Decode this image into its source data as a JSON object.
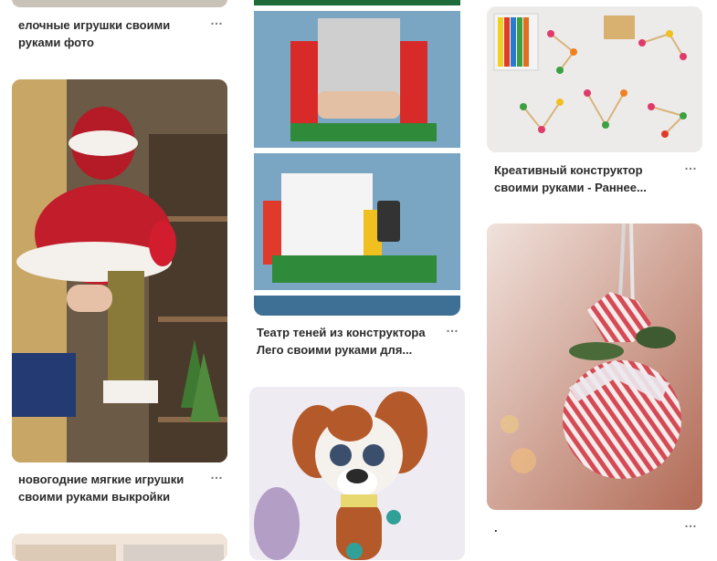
{
  "pins": [
    {
      "title": "елочные игрушки своими руками фото",
      "image": "christmas-toys-photo"
    },
    {
      "title": "новогодние мягкие игрушки своими руками выкройки",
      "image": "santa-claus-soft-toy"
    },
    {
      "title": "Театр теней из конструктора Лего своими руками для...",
      "image": "lego-shadow-theater"
    },
    {
      "title": "",
      "image": "crochet-dog-toy"
    },
    {
      "title": "Креативный конструктор своими руками - Раннее...",
      "image": "plasticine-stick-constructor"
    },
    {
      "title": ".",
      "image": "striped-christmas-ball"
    },
    {
      "title": "",
      "image": "beaded-pattern-preview"
    }
  ],
  "more_icon": "…",
  "icons": [
    "more-options-icon"
  ],
  "colors": {
    "text": "#2b2b2b",
    "muted": "#7a7a7a",
    "background": "#ffffff"
  }
}
